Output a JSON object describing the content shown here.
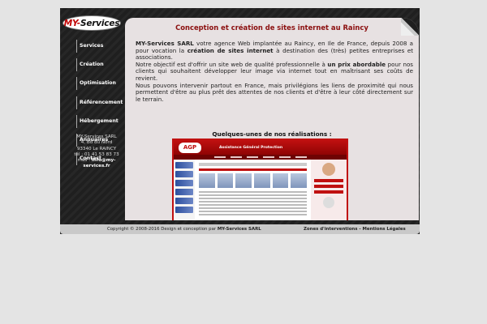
{
  "logo": {
    "part1": "MY-",
    "part2": "Services"
  },
  "nav": [
    "Services",
    "Création",
    "Optimisation",
    "Référencement",
    "Hébergement",
    "Annuaires",
    "Contact"
  ],
  "address": {
    "company": "MY-Services SARL",
    "street": "4, Bd du Nord",
    "city": "93340 Le RAINCY",
    "tel": "tél : 01 41 53 83 73",
    "mail_prefix": "mail : ",
    "mail": "info@my-services.fr"
  },
  "content": {
    "heading": "Conception et création de sites internet au Raincy",
    "p1": {
      "b1": "MY-Services SARL",
      "t1": " votre agence Web implantée au Raincy, en Ile de France, depuis 2008 a pour vocation la ",
      "b2": "création de sites internet",
      "t2": " à destination des (très) petites entreprises et associations."
    },
    "p2": {
      "t1": "Notre objectif est d'offrir un site web de qualité professionnelle à ",
      "b1": "un prix abordable",
      "t2": " pour nos clients qui souhaitent développer leur image via internet tout en maîtrisant ses coûts de revient."
    },
    "p3": "Nous pouvons intervenir partout en France, mais privilégions les liens de proximité qui nous permettent d'être au plus prêt des attentes de nos clients et d'être à leur côté directement sur le terrain.",
    "gallery_title": "Quelques-unes de nos réalisations :"
  },
  "preview": {
    "logo": "AGP",
    "brand": "Assistance Général Protection"
  },
  "footer": {
    "copyright_prefix": "Copyright © 2008-2016 Design et conception par ",
    "copyright_company": "MY-Services SARL",
    "link1": "Zones d'interventions",
    "separator": " - ",
    "link2": "Mentions Légales"
  },
  "colors": {
    "heading": "#8b0f0f",
    "frame": "#1f1f1f",
    "content_bg": "#e7e1e2",
    "accent_red": "#c01010"
  }
}
